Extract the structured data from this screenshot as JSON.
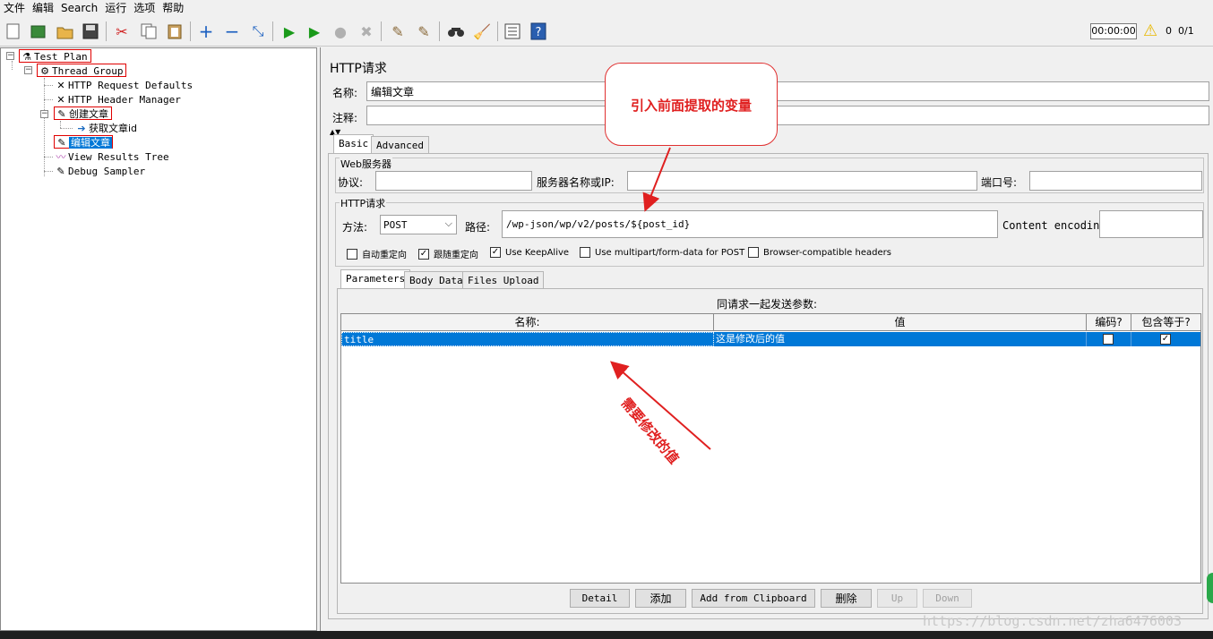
{
  "menu": [
    "文件",
    "编辑",
    "Search",
    "运行",
    "选项",
    "帮助"
  ],
  "toolbar": {
    "timer": "00:00:00",
    "warning_count": "0",
    "thread_ratio": "0/1"
  },
  "tree": {
    "test_plan": "Test Plan",
    "thread_group": "Thread Group",
    "http_defaults": "HTTP Request Defaults",
    "header_manager": "HTTP Header Manager",
    "create_article": "创建文章",
    "get_article_id": "获取文章id",
    "edit_article": "编辑文章",
    "view_results_tree": "View Results Tree",
    "debug_sampler": "Debug Sampler"
  },
  "panel": {
    "title": "HTTP请求",
    "name_label": "名称:",
    "name_value": "编辑文章",
    "comment_label": "注释:",
    "tabs": [
      "Basic",
      "Advanced"
    ],
    "web_server_legend": "Web服务器",
    "protocol_label": "协议:",
    "server_label": "服务器名称或IP:",
    "port_label": "端口号:",
    "http_legend": "HTTP请求",
    "method_label": "方法:",
    "method_value": "POST",
    "path_label": "路径:",
    "path_value": "/wp-json/wp/v2/posts/${post_id}",
    "encoding_label": "Content encoding:",
    "checkboxes": [
      {
        "label": "自动重定向",
        "checked": false
      },
      {
        "label": "跟随重定向",
        "checked": true
      },
      {
        "label": "Use KeepAlive",
        "checked": true
      },
      {
        "label": "Use multipart/form-data for POST",
        "checked": false
      },
      {
        "label": "Browser-compatible headers",
        "checked": false
      }
    ],
    "subtabs": [
      "Parameters",
      "Body Data",
      "Files Upload"
    ],
    "params_caption": "同请求一起发送参数:",
    "columns": [
      "名称:",
      "值",
      "编码?",
      "包含等于?"
    ],
    "rows": [
      {
        "name": "title",
        "value": "这是修改后的值",
        "encode": false,
        "include_equals": true
      }
    ],
    "buttons": [
      "Detail",
      "添加",
      "Add from Clipboard",
      "删除",
      "Up",
      "Down"
    ]
  },
  "annotations": {
    "bubble_text": "引入前面提取的变量",
    "arrow_note": "需要修改的值",
    "watermark": "https://blog.csdn.net/zha6476003"
  },
  "colors": {
    "selection": "#0078d7",
    "annotation_red": "#e02020"
  }
}
